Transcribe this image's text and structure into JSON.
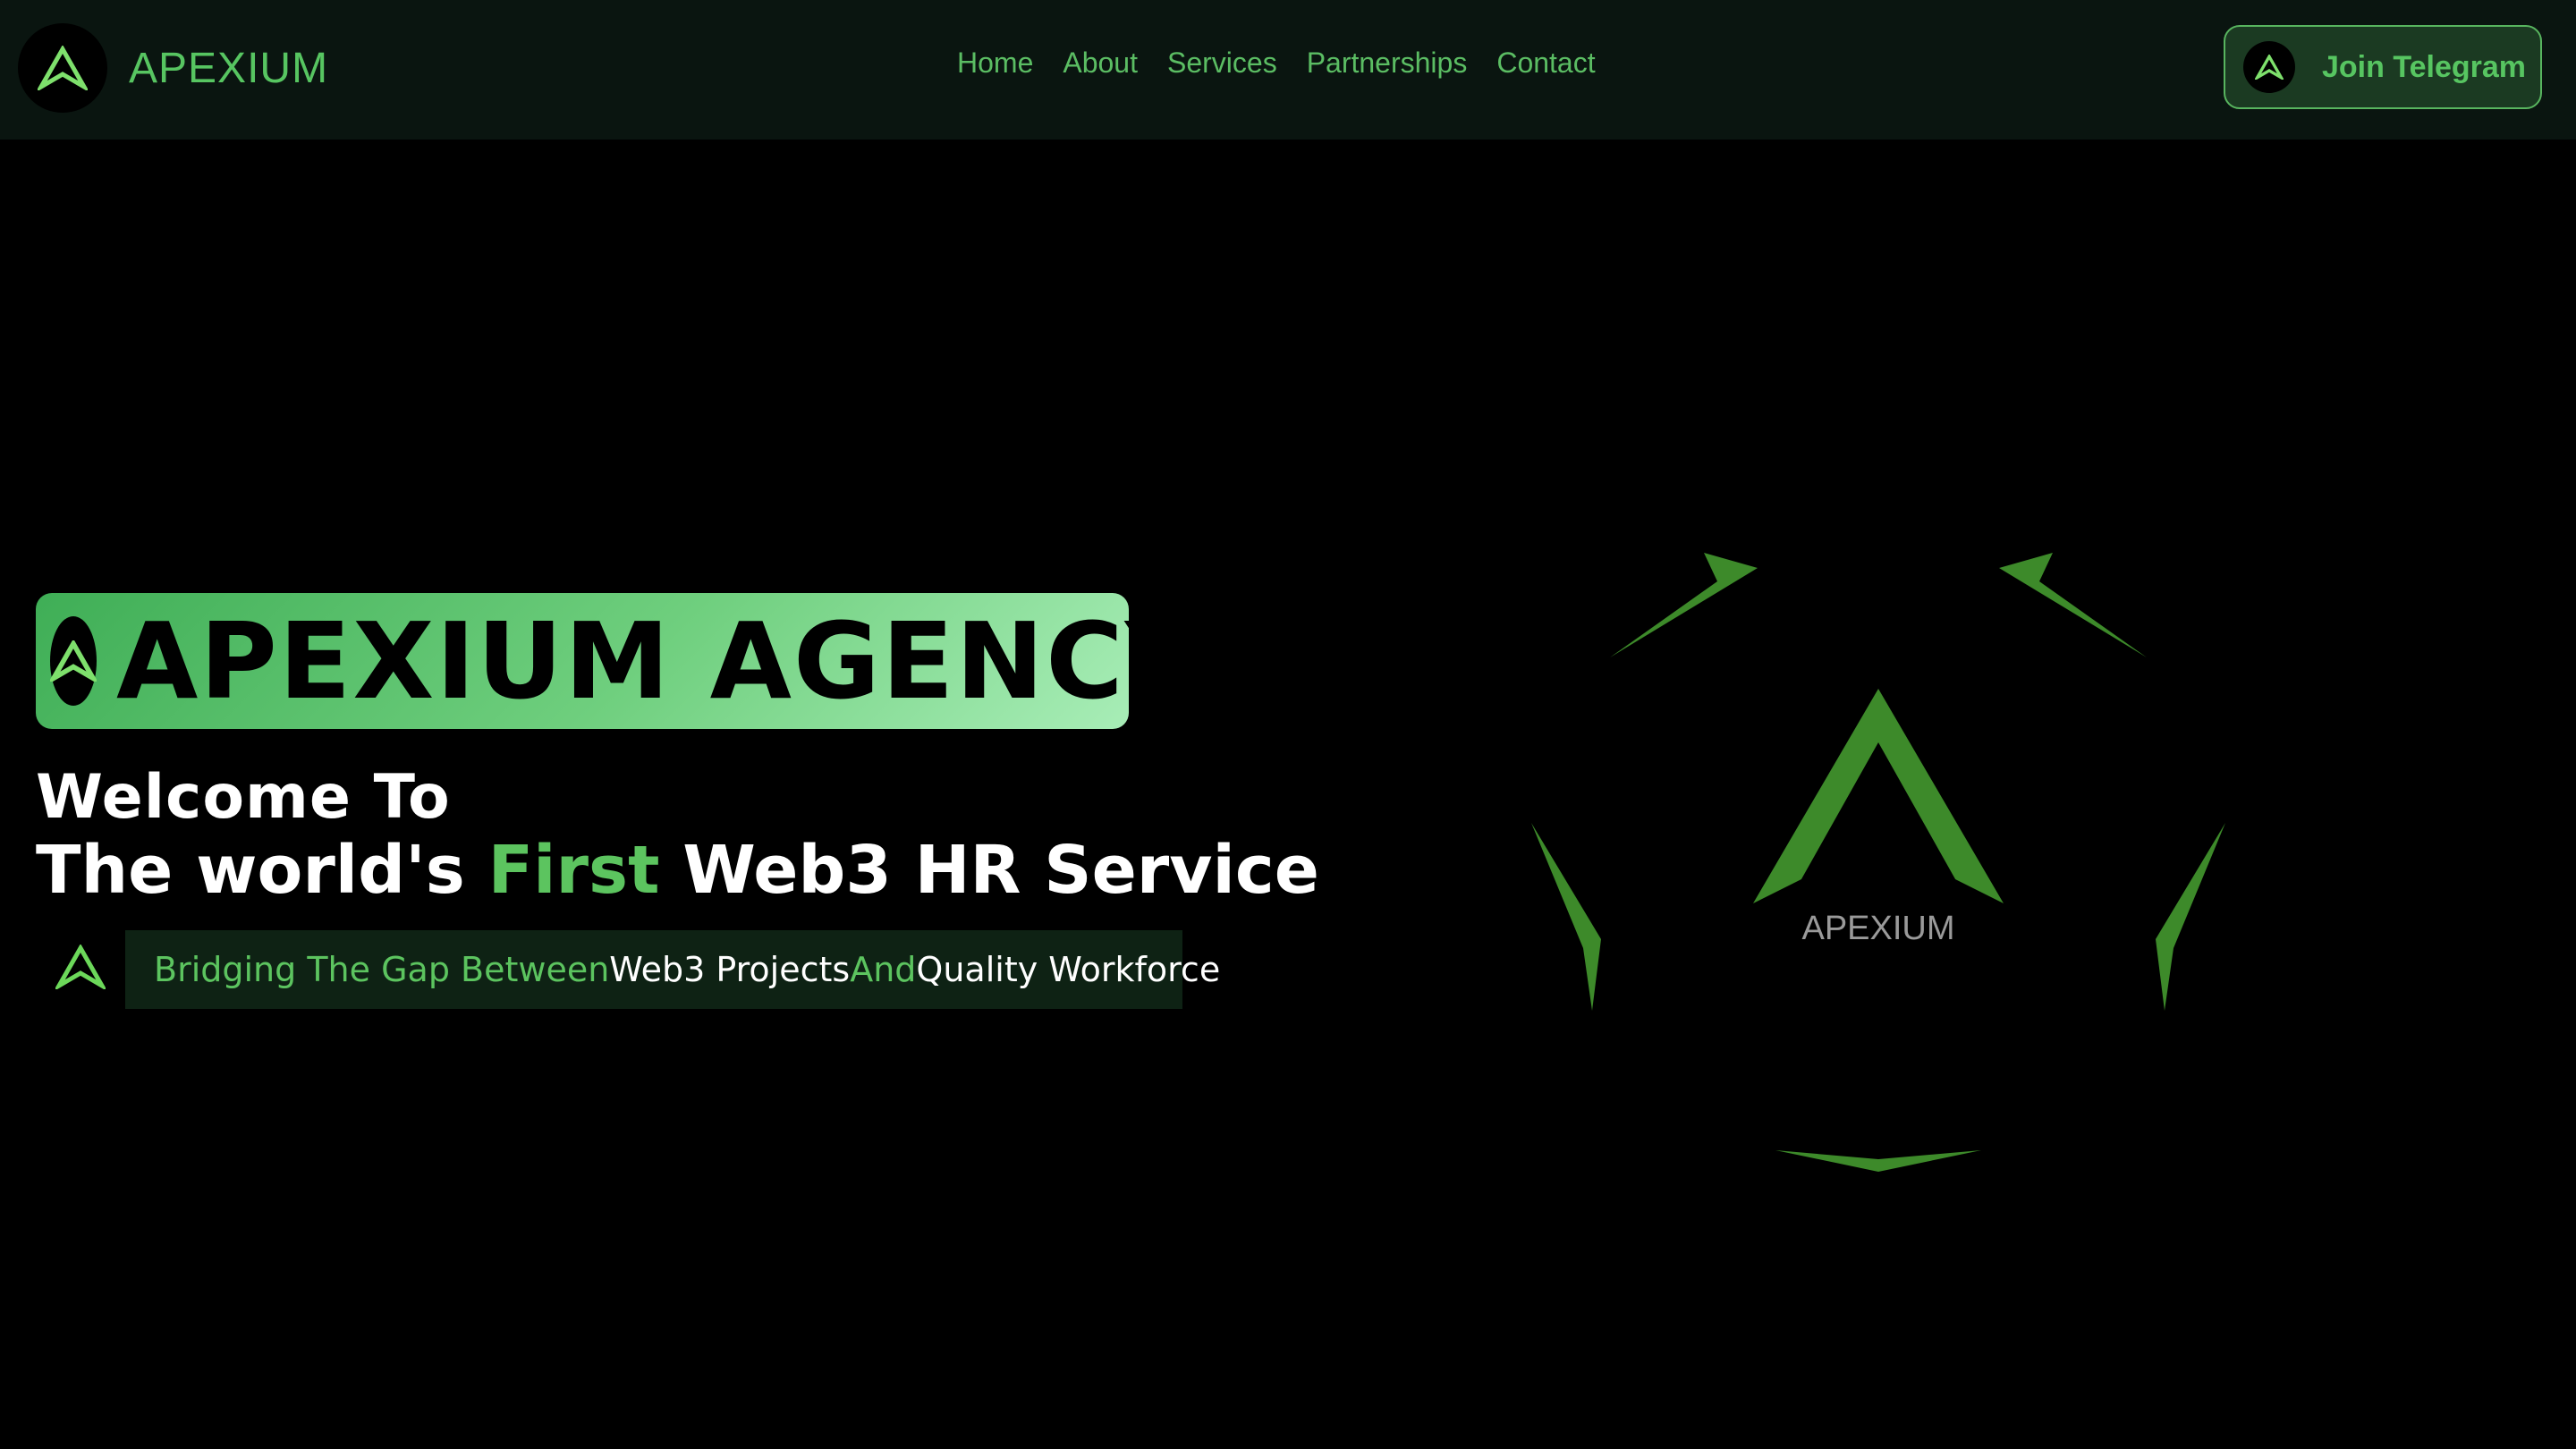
{
  "brand": {
    "name": "APEXIUM",
    "logo_icon": "apexium-logo-icon"
  },
  "nav": {
    "links": [
      {
        "label": "Home"
      },
      {
        "label": "About"
      },
      {
        "label": "Services"
      },
      {
        "label": "Partnerships"
      },
      {
        "label": "Contact"
      }
    ],
    "telegram_button": {
      "label": "Join Telegram",
      "icon": "apexium-logo-icon"
    }
  },
  "hero": {
    "badge_title": "APEXIUM AGENCY",
    "welcome": "Welcome To",
    "headline_part1": "The world's ",
    "headline_highlight": "First",
    "headline_part2": " Web3 HR Service",
    "tagline": {
      "part1": "Bridging The Gap Between ",
      "part2": "Web3 Projects",
      "part3": " And ",
      "part4": "Quality Workforce"
    },
    "art_label": "APEXIUM"
  },
  "colors": {
    "accent": "#57c561",
    "nav_background": "#0a1510",
    "page_background": "#000000",
    "badge_gradient_start": "#3fae56",
    "badge_gradient_end": "#a8edb7"
  }
}
